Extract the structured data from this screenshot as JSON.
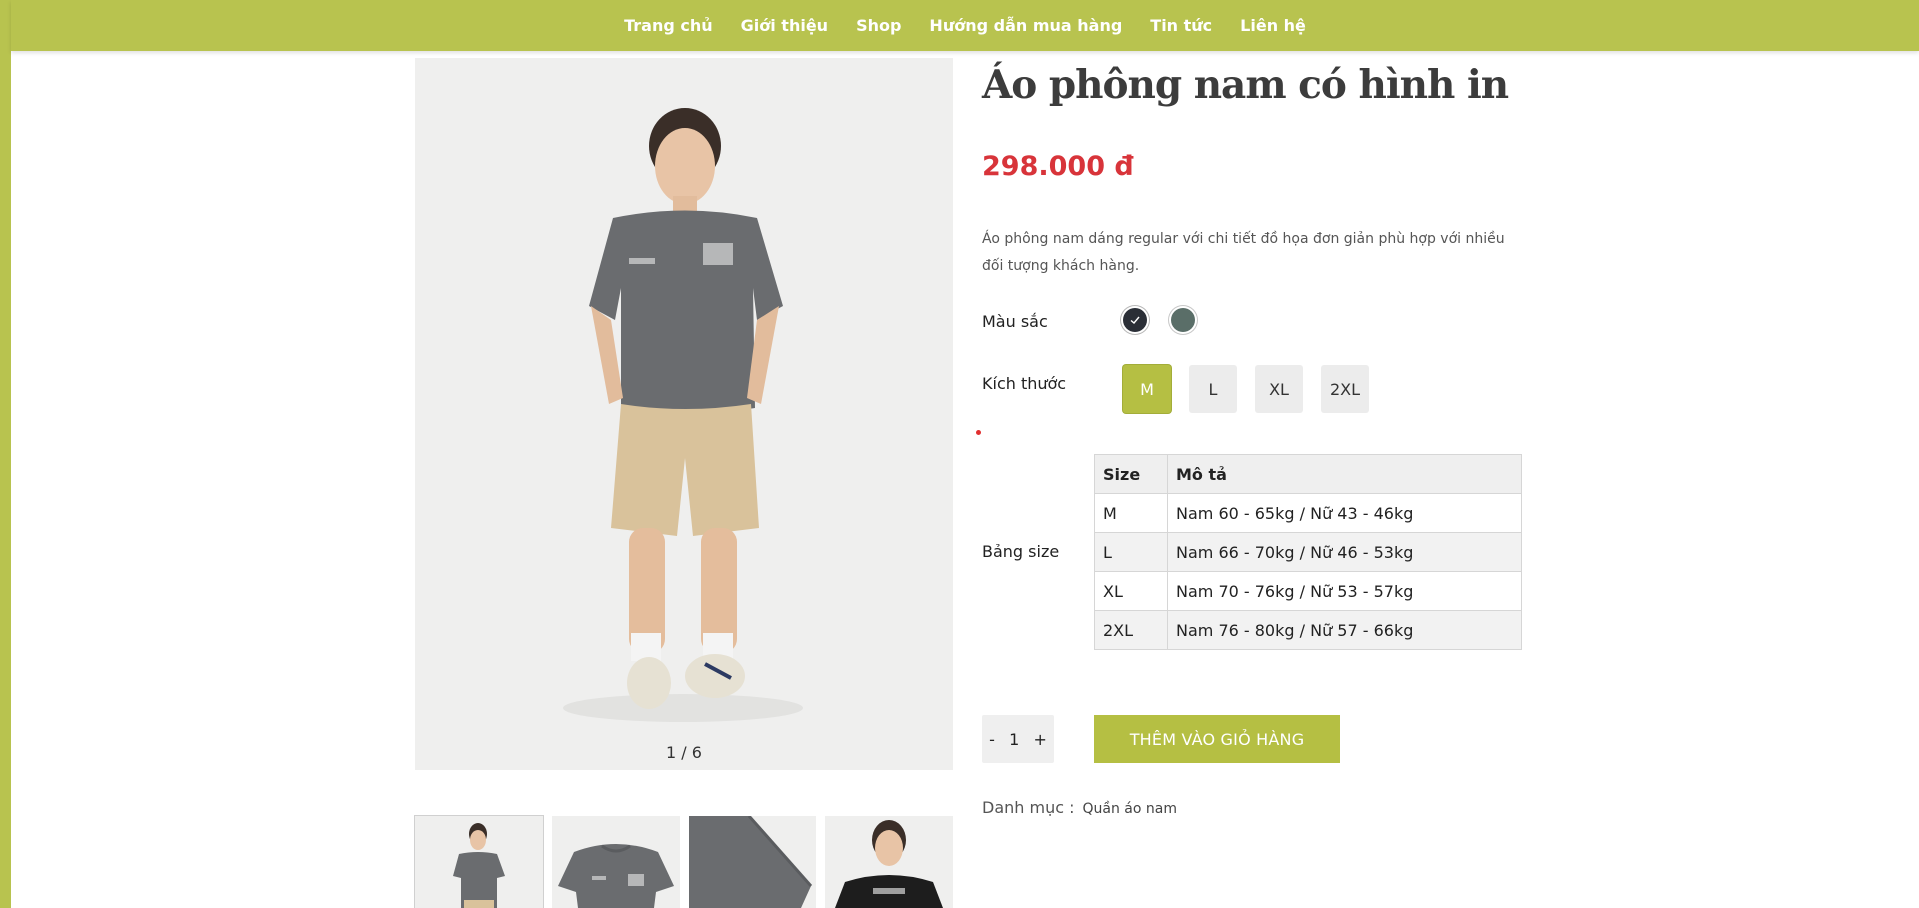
{
  "nav": {
    "items": [
      "Trang chủ",
      "Giới thiệu",
      "Shop",
      "Hướng dẫn mua hàng",
      "Tin tức",
      "Liên hệ"
    ]
  },
  "gallery": {
    "counter": "1 / 6",
    "thumbnails": [
      "thumb-1",
      "thumb-2",
      "thumb-3",
      "thumb-4"
    ]
  },
  "product": {
    "title": "Áo phông nam có hình in",
    "price": "298.000 đ",
    "description": "Áo phông nam dáng regular với chi tiết đồ họa đơn giản phù hợp với nhiều đối tượng khách hàng."
  },
  "options": {
    "color_label": "Màu sắc",
    "colors": [
      "#2a2e36",
      "#5a6e68"
    ],
    "selected_color_index": 0,
    "size_label": "Kích thước",
    "sizes": [
      "M",
      "L",
      "XL",
      "2XL"
    ],
    "selected_size": "M"
  },
  "size_chart": {
    "label": "Bảng size",
    "headers": [
      "Size",
      "Mô tả"
    ],
    "rows": [
      [
        "M",
        "Nam 60 - 65kg / Nữ 43 - 46kg"
      ],
      [
        "L",
        "Nam 66 - 70kg / Nữ 46 - 53kg"
      ],
      [
        "XL",
        "Nam 70 - 76kg / Nữ 53 - 57kg"
      ],
      [
        "2XL",
        "Nam 76 - 80kg / Nữ 57 - 66kg"
      ]
    ]
  },
  "cart": {
    "qty_minus": "-",
    "qty_value": "1",
    "qty_plus": "+",
    "add_label": "THÊM VÀO GIỎ HÀNG"
  },
  "category": {
    "label": "Danh mục :",
    "value": "Quần áo nam"
  },
  "colors": {
    "accent": "#b8c34f",
    "price": "#d8343a"
  }
}
